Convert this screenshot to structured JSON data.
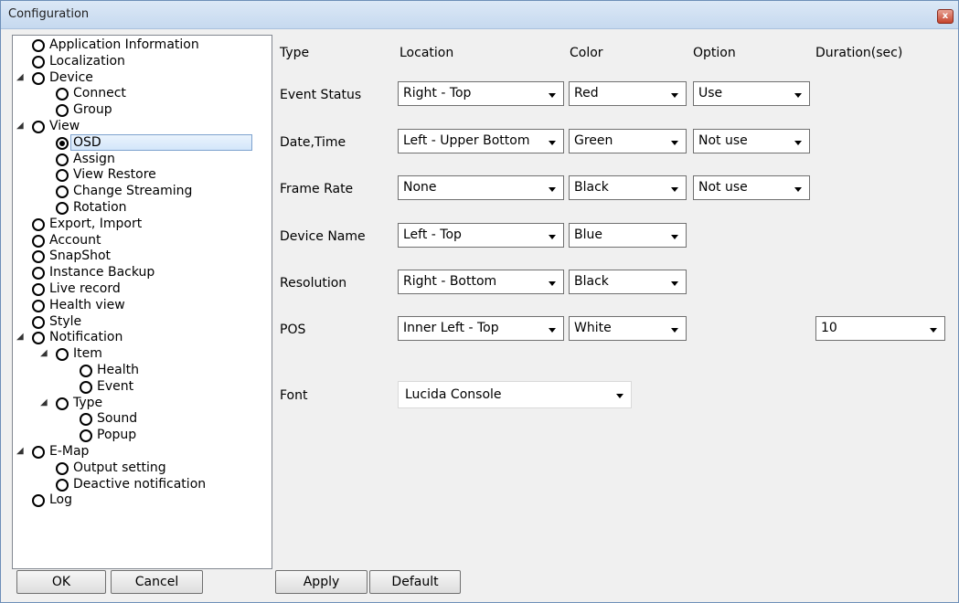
{
  "window": {
    "title": "Configuration",
    "close_glyph": "x"
  },
  "tree": {
    "items": [
      {
        "label": "Application Information"
      },
      {
        "label": "Localization"
      },
      {
        "label": "Device"
      },
      {
        "label": "Connect"
      },
      {
        "label": "Group"
      },
      {
        "label": "View"
      },
      {
        "label": "OSD"
      },
      {
        "label": "Assign"
      },
      {
        "label": "View Restore"
      },
      {
        "label": "Change Streaming"
      },
      {
        "label": "Rotation"
      },
      {
        "label": "Export, Import"
      },
      {
        "label": "Account"
      },
      {
        "label": "SnapShot"
      },
      {
        "label": "Instance Backup"
      },
      {
        "label": "Live record"
      },
      {
        "label": "Health view"
      },
      {
        "label": "Style"
      },
      {
        "label": "Notification"
      },
      {
        "label": "Item"
      },
      {
        "label": "Health"
      },
      {
        "label": "Event"
      },
      {
        "label": "Type"
      },
      {
        "label": "Sound"
      },
      {
        "label": "Popup"
      },
      {
        "label": "E-Map"
      },
      {
        "label": "Output setting"
      },
      {
        "label": "Deactive notification"
      },
      {
        "label": "Log"
      }
    ],
    "selected": "OSD"
  },
  "headers": {
    "type": "Type",
    "location": "Location",
    "color": "Color",
    "option": "Option",
    "duration": "Duration(sec)"
  },
  "rows": {
    "event_status": {
      "label": "Event Status",
      "location": "Right - Top",
      "color": "Red",
      "option": "Use"
    },
    "date_time": {
      "label": "Date,Time",
      "location": "Left - Upper Bottom",
      "color": "Green",
      "option": "Not use"
    },
    "frame_rate": {
      "label": "Frame Rate",
      "location": "None",
      "color": "Black",
      "option": "Not use"
    },
    "device_name": {
      "label": "Device Name",
      "location": "Left - Top",
      "color": "Blue"
    },
    "resolution": {
      "label": "Resolution",
      "location": "Right - Bottom",
      "color": "Black"
    },
    "pos": {
      "label": "POS",
      "location": "Inner Left - Top",
      "color": "White",
      "duration": "10"
    }
  },
  "font": {
    "label": "Font",
    "value": "Lucida Console"
  },
  "buttons": {
    "ok": "OK",
    "cancel": "Cancel",
    "apply": "Apply",
    "default": "Default"
  }
}
